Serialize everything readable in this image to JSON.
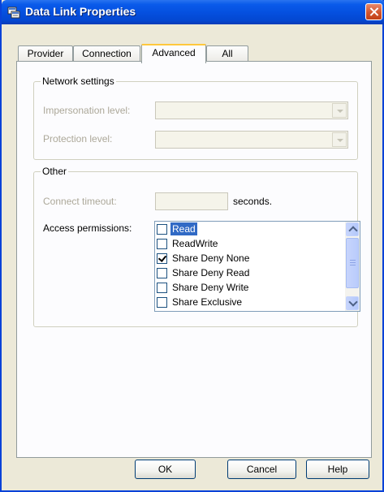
{
  "window": {
    "title": "Data Link Properties",
    "close_label": "×"
  },
  "tabs": [
    {
      "label": "Provider",
      "active": false
    },
    {
      "label": "Connection",
      "active": false
    },
    {
      "label": "Advanced",
      "active": true
    },
    {
      "label": "All",
      "active": false
    }
  ],
  "network_settings": {
    "title": "Network settings",
    "impersonation_label": "Impersonation level:",
    "impersonation_value": "",
    "protection_label": "Protection level:",
    "protection_value": ""
  },
  "other": {
    "title": "Other",
    "timeout_label": "Connect timeout:",
    "timeout_value": "",
    "timeout_unit": "seconds.",
    "access_label": "Access permissions:",
    "permissions": [
      {
        "label": "Read",
        "checked": false,
        "selected": true
      },
      {
        "label": "ReadWrite",
        "checked": false,
        "selected": false
      },
      {
        "label": "Share Deny None",
        "checked": true,
        "selected": false
      },
      {
        "label": "Share Deny Read",
        "checked": false,
        "selected": false
      },
      {
        "label": "Share Deny Write",
        "checked": false,
        "selected": false
      },
      {
        "label": "Share Exclusive",
        "checked": false,
        "selected": false
      }
    ]
  },
  "buttons": {
    "ok": "OK",
    "cancel": "Cancel",
    "help": "Help"
  },
  "colors": {
    "titlebar": "#0550e0",
    "selection": "#316ac5",
    "active_tab_accent": "#ffc83c"
  }
}
